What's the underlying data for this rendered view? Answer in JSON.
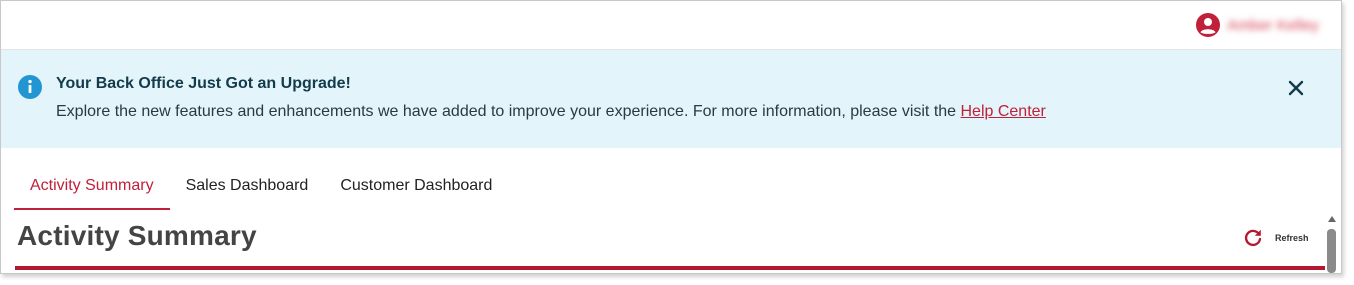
{
  "header": {
    "user_name": "Amber Kelley",
    "avatar_icon": "user-avatar-icon"
  },
  "banner": {
    "icon": "info-icon",
    "title": "Your Back Office Just Got an Upgrade!",
    "message": "Explore the new features and enhancements we have added to improve your experience. For more information, please visit the ",
    "link_label": "Help Center",
    "close_icon": "close-icon"
  },
  "tabs": [
    {
      "label": "Activity Summary",
      "active": true
    },
    {
      "label": "Sales Dashboard",
      "active": false
    },
    {
      "label": "Customer Dashboard",
      "active": false
    }
  ],
  "main": {
    "title": "Activity Summary",
    "refresh_label": "Refresh",
    "refresh_icon": "refresh-icon"
  },
  "colors": {
    "accent": "#c0203a",
    "banner_bg": "#e3f4fa",
    "info_blue": "#2196d3",
    "rule": "#b3182e"
  }
}
